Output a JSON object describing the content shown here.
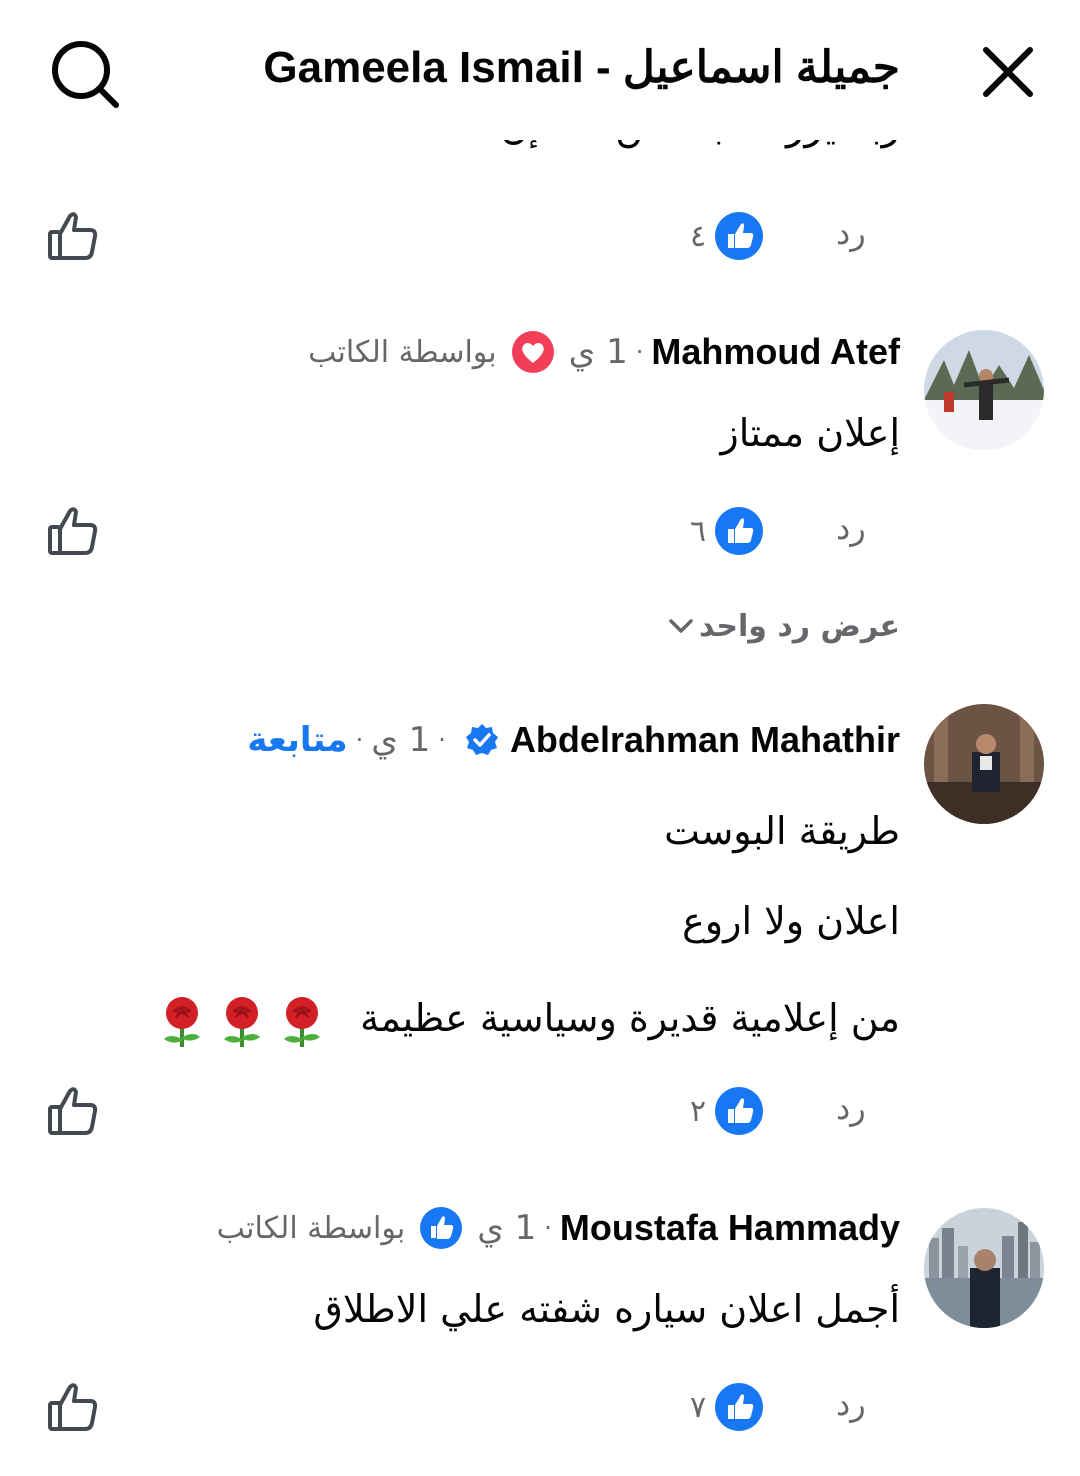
{
  "header": {
    "title": "Gameela Ismail - جميلة اسماعيل"
  },
  "clipped_comment": {
    "text": "ربنا يرزقك بأحسن منه إن شاء الله",
    "likes": "٤",
    "reply_label": "رد"
  },
  "comments": [
    {
      "author": "Mahmoud Atef",
      "time": "1 ي",
      "by_author": "بواسطة الكاتب",
      "author_reaction": "love",
      "lines": [
        "إعلان ممتاز"
      ],
      "likes": "٦",
      "reply_label": "رد",
      "view_replies": "عرض رد واحد"
    },
    {
      "author": "Abdelrahman Mahathir",
      "verified": true,
      "time": "1 ي",
      "follow_label": "متابعة",
      "lines": [
        "طريقة البوست",
        "اعلان ولا اروع",
        "من إعلامية قديرة وسياسية  عظيمة"
      ],
      "emoji": "🌹🌹🌹",
      "likes": "٢",
      "reply_label": "رد"
    },
    {
      "author": "Moustafa Hammady",
      "time": "1 ي",
      "by_author": "بواسطة الكاتب",
      "author_reaction": "like",
      "lines": [
        "أجمل اعلان سياره شفته علي الاطلاق"
      ],
      "likes": "٧",
      "reply_label": "رد"
    }
  ],
  "colors": {
    "facebook_blue": "#1877f2",
    "love_red": "#f33e58",
    "secondary_text": "#65676b",
    "primary_text": "#050505"
  },
  "icons": [
    "search-icon",
    "close-icon",
    "like-outline-icon",
    "like-reaction-icon",
    "love-reaction-icon",
    "verified-badge-icon",
    "chevron-down-icon",
    "rose-emoji"
  ]
}
